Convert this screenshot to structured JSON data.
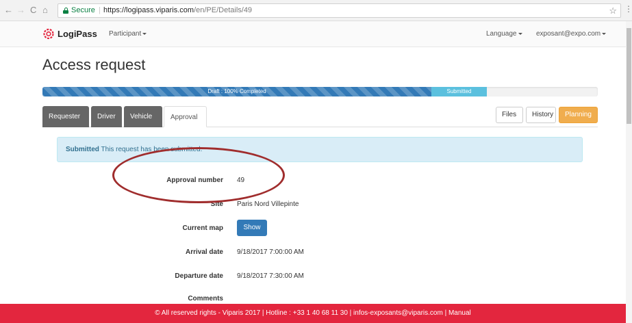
{
  "browser": {
    "secure_label": "Secure",
    "url_host": "https://logipass.viparis.com",
    "url_path": "/en/PE/Details/49",
    "nav_back": "←",
    "nav_forward": "→",
    "nav_reload": "C",
    "nav_home": "⌂",
    "star": "☆",
    "menu": "⋮"
  },
  "navbar": {
    "brand": "LogiPass",
    "participant": "Participant",
    "language": "Language",
    "user": "exposant@expo.com"
  },
  "page": {
    "title": "Access request"
  },
  "progress": {
    "draft_label": "Draft : 100% Completed",
    "draft_fraction": 0.7,
    "submitted_label": "Submitted",
    "submitted_fraction": 0.1,
    "colors": {
      "draft": "#337ab7",
      "submitted": "#5bc0de"
    }
  },
  "tabs": [
    {
      "label": "Requester"
    },
    {
      "label": "Driver"
    },
    {
      "label": "Vehicle"
    },
    {
      "label": "Approval",
      "active": true
    }
  ],
  "actions": {
    "files": "Files",
    "history": "History",
    "planning": "Planning"
  },
  "alert": {
    "strong": "Submitted",
    "text": " This request has been submitted."
  },
  "details": {
    "approval_number_label": "Approval number",
    "approval_number": "49",
    "site_label": "Site",
    "site": "Paris Nord Villepinte",
    "current_map_label": "Current map",
    "show_button": "Show",
    "arrival_label": "Arrival date",
    "arrival": "9/18/2017 7:00:00 AM",
    "departure_label": "Departure date",
    "departure": "9/18/2017 7:30:00 AM",
    "comments_label": "Comments"
  },
  "footer": {
    "text": "© All reserved rights - Viparis 2017 | Hotline : +33 1 40 68 11 30 | infos-exposants@viparis.com | Manual"
  },
  "colors": {
    "footer": "#e3263e",
    "planning": "#f0ad4e",
    "annotation": "#a02d2d"
  }
}
